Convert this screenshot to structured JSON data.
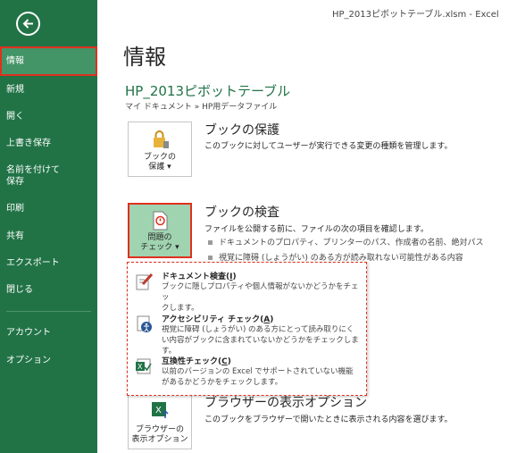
{
  "window": {
    "title": "HP_2013ピボットテーブル.xlsm - Excel"
  },
  "sidebar": {
    "items": [
      {
        "label": "情報"
      },
      {
        "label": "新規"
      },
      {
        "label": "開く"
      },
      {
        "label": "上書き保存"
      },
      {
        "label": "名前を付けて"
      },
      {
        "label": "保存"
      },
      {
        "label": "印刷"
      },
      {
        "label": "共有"
      },
      {
        "label": "エクスポート"
      },
      {
        "label": "閉じる"
      },
      {
        "label": "アカウント"
      },
      {
        "label": "オプション"
      }
    ]
  },
  "main": {
    "title": "情報",
    "file_name": "HP_2013ピボットテーブル",
    "breadcrumb": "マイ ドキュメント » HP用データファイル",
    "protect": {
      "button_line1": "ブックの",
      "button_line2": "保護",
      "button_arrow": "▾",
      "title": "ブックの保護",
      "description": "このブックに対してユーザーが実行できる変更の種類を管理します。"
    },
    "inspect": {
      "button_line1": "問題の",
      "button_line2": "チェック",
      "button_arrow": "▾",
      "title": "ブックの検査",
      "description": "ファイルを公開する前に、ファイルの次の項目を確認します。",
      "bullets": [
        "ドキュメントのプロパティ、プリンターのパス、作成者の名前、絶対パス",
        "視覚に障碍 (しょうがい) のある方が読み取れない可能性がある内容"
      ]
    },
    "browser": {
      "button_line1": "ブラウザーの",
      "button_line2": "表示オプション",
      "title": "ブラウザーの表示オプション",
      "description": "このブックをブラウザーで開いたときに表示される内容を選びます。"
    }
  },
  "dropdown": {
    "items": [
      {
        "title_pre": "ドキュメント検査(",
        "title_key": "I",
        "title_post": ")",
        "desc_line1": "ブックに隠しプロパティや個人情報がないかどうかをチェッ",
        "desc_line2": "クします。",
        "icon": "document-inspector-icon"
      },
      {
        "title_pre": "アクセシビリティ チェック(",
        "title_key": "A",
        "title_post": ")",
        "desc_line1": "視覚に障碍 (しょうがい) のある方にとって読み取りにく",
        "desc_line2": "い内容がブックに含まれていないかどうかをチェックします。",
        "icon": "accessibility-checker-icon"
      },
      {
        "title_pre": "互換性チェック(",
        "title_key": "C",
        "title_post": ")",
        "desc_line1": "以前のバージョンの Excel でサポートされていない機能",
        "desc_line2": "があるかどうかをチェックします。",
        "icon": "compatibility-checker-icon"
      }
    ]
  },
  "colors": {
    "sidebar_bg": "#217346",
    "sidebar_selected": "#439467",
    "accent_green": "#217346",
    "highlight_red": "#e0301e",
    "active_button": "#a0d3b0"
  }
}
